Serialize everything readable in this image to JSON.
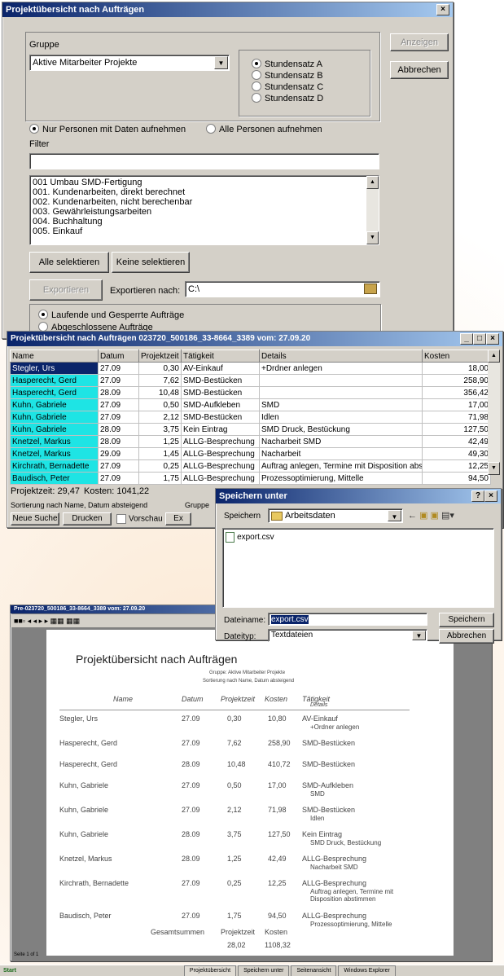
{
  "dialog1": {
    "title": "Projektübersicht nach Aufträgen",
    "close": "×",
    "group_label": "Gruppe",
    "group_value": "Aktive Mitarbeiter Projekte",
    "rates": [
      "Stundensatz A",
      "Stundensatz B",
      "Stundensatz C",
      "Stundensatz D"
    ],
    "btn_anzeigen": "Anzeigen",
    "btn_abbrechen": "Abbrechen",
    "radio_nur": "Nur Personen mit Daten aufnehmen",
    "radio_alle": "Alle Personen aufnehmen",
    "filter_label": "Filter",
    "filter_value": "",
    "projects": [
      "001 Umbau SMD-Fertigung",
      "001. Kundenarbeiten, direkt berechnet",
      "002. Kundenarbeiten, nicht berechenbar",
      "003. Gewährleistungsarbeiten",
      "004. Buchhaltung",
      "005. Einkauf"
    ],
    "btn_alle": "Alle selektieren",
    "btn_keine": "Keine selektieren",
    "btn_exportieren": "Exportieren",
    "export_label": "Exportieren nach:",
    "export_value": "C:\\",
    "radio_laufend": "Laufende und Gesperrte Aufträge",
    "radio_abgeschlossen": "Abgeschlossene Aufträge"
  },
  "dialog2": {
    "title": "Projektübersicht nach Aufträgen       023720_500186_33-8664_3389 vom: 27.09.20",
    "columns": [
      "Name",
      "Datum",
      "Projektzeit",
      "Tätigkeit",
      "Details",
      "Kosten"
    ],
    "rows": [
      [
        "Stegler, Urs",
        "27.09",
        "0,30",
        "AV-Einkauf",
        "+Drdner anlegen",
        "18,00"
      ],
      [
        "Hasperecht, Gerd",
        "27.09",
        "7,62",
        "SMD-Bestücken",
        "",
        "258,90"
      ],
      [
        "Hasperecht, Gerd",
        "28.09",
        "10,48",
        "SMD-Bestücken",
        "",
        "356,42"
      ],
      [
        "Kuhn, Gabriele",
        "27.09",
        "0,50",
        "SMD-Aufkleben",
        "SMD",
        "17,00"
      ],
      [
        "Kuhn, Gabriele",
        "27.09",
        "2,12",
        "SMD-Bestücken",
        "Idlen",
        "71,98"
      ],
      [
        "Kuhn, Gabriele",
        "28.09",
        "3,75",
        "Kein Eintrag",
        "SMD Druck, Bestückung",
        "127,50"
      ],
      [
        "Knetzel, Markus",
        "28.09",
        "1,25",
        "ALLG-Besprechung",
        "Nacharbeit SMD",
        "42,49"
      ],
      [
        "Knetzel, Markus",
        "29.09",
        "1,45",
        "ALLG-Besprechung",
        "Nacharbeit",
        "49,30"
      ],
      [
        "Kirchrath, Bernadette",
        "27.09",
        "0,25",
        "ALLG-Besprechung",
        "Auftrag anlegen, Termine mit Disposition abstimmen",
        "12,25"
      ],
      [
        "Baudisch, Peter",
        "27.09",
        "1,75",
        "ALLG-Besprechung",
        "Prozessoptimierung, Mittelle",
        "94,50"
      ]
    ],
    "projektzeit": "Projektzeit: 29,47",
    "kosten": "Kosten: 1041,22",
    "sort_label": "Sortierung nach Name, Datum absteigend",
    "gruppe_label": "Gruppe",
    "btn_neue": "Neue Suche",
    "btn_drucken": "Drucken",
    "vorschau": "Vorschau",
    "btn_ex": "Ex"
  },
  "dialog3": {
    "title": "Speichern unter",
    "help": "?",
    "close": "×",
    "speichern_in_label": "Speichern",
    "folder": "Arbeitsdaten",
    "file": "export.csv",
    "dateiname_label": "Dateiname:",
    "dateiname_value": "export.csv",
    "dateityp_label": "Dateityp:",
    "dateityp_value": "Textdateien",
    "btn_speichern": "Speichern",
    "btn_abbrechen": "Abbrechen"
  },
  "preview": {
    "title": "Pre-023720_500186_33-8664_3389 vom: 27.09.20",
    "heading": "Projektübersicht nach Aufträgen",
    "sub1": "Gruppe: Aktive Mitarbeiter Projekte",
    "sub2": "Sortierung nach Name, Datum absteigend",
    "columns": [
      "Name",
      "Datum",
      "Projektzeit",
      "Kosten",
      "Tätigkeit",
      "Details"
    ],
    "rows": [
      [
        "Stegler, Urs",
        "27.09",
        "0,30",
        "10,80",
        "AV-Einkauf",
        "+Ordner anlegen"
      ],
      [
        "Hasperecht, Gerd",
        "27.09",
        "7,62",
        "258,90",
        "SMD-Bestücken",
        ""
      ],
      [
        "Hasperecht, Gerd",
        "28.09",
        "10,48",
        "410,72",
        "SMD-Bestücken",
        ""
      ],
      [
        "Kuhn, Gabriele",
        "27.09",
        "0,50",
        "17,00",
        "SMD-Aufkleben",
        "SMD"
      ],
      [
        "Kuhn, Gabriele",
        "27.09",
        "2,12",
        "71,98",
        "SMD-Bestücken",
        "Idlen"
      ],
      [
        "Kuhn, Gabriele",
        "28.09",
        "3,75",
        "127,50",
        "Kein Eintrag",
        "SMD Druck, Bestückung"
      ],
      [
        "Knetzel, Markus",
        "28.09",
        "1,25",
        "42,49",
        "ALLG-Besprechung",
        "Nacharbeit SMD"
      ],
      [
        "Kirchrath, Bernadette",
        "27.09",
        "0,25",
        "12,25",
        "ALLG-Besprechung",
        "Auftrag anlegen, Termine mit Disposition abstimmen"
      ],
      [
        "Baudisch, Peter",
        "27.09",
        "1,75",
        "94,50",
        "ALLG-Besprechung",
        "Prozessoptimierung, Mittelle"
      ]
    ],
    "gesamt_label": "Gesamtsummen",
    "gesamt_pz_label": "Projektzeit",
    "gesamt_k_label": "Kosten",
    "gesamt_pz": "28,02",
    "gesamt_k": "1108,32",
    "page": "Seite 1 of 1"
  },
  "taskbar": {
    "start": "Start",
    "items": [
      "Projektübersicht",
      "Speichern unter",
      "Seitenansicht",
      "Windows Explorer"
    ]
  }
}
